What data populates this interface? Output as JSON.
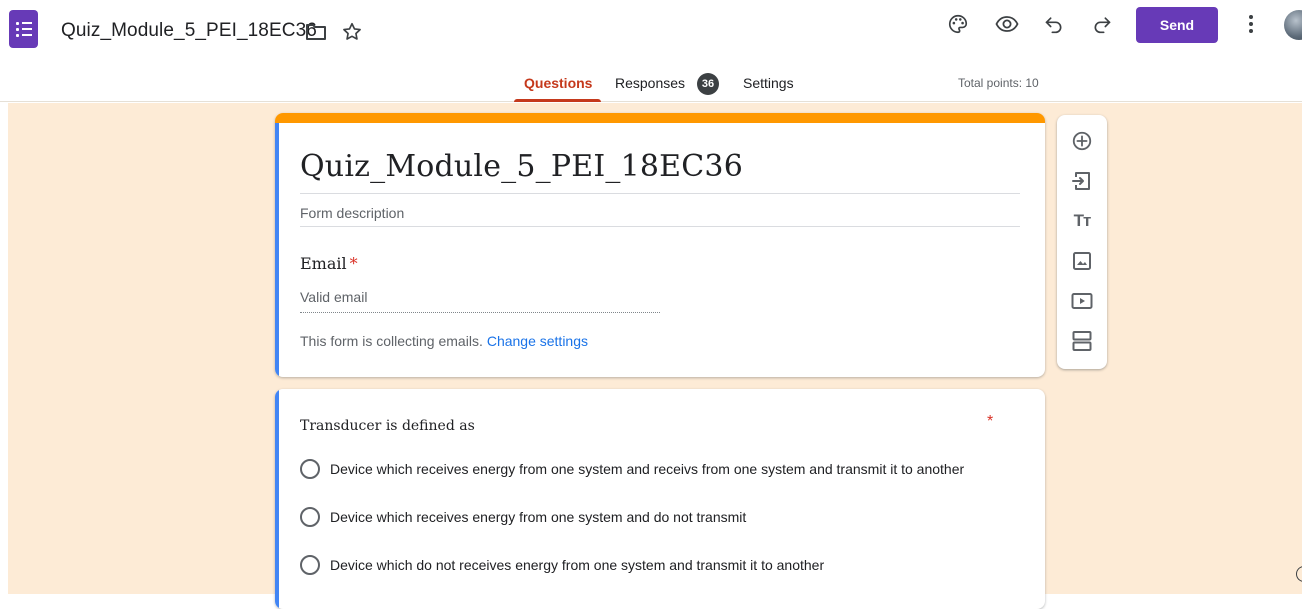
{
  "header": {
    "doc_title": "Quiz_Module_5_PEI_18EC36",
    "send_label": "Send",
    "icons": [
      "forms-logo-icon",
      "folder-icon",
      "star-icon",
      "palette-icon",
      "preview-eye-icon",
      "undo-icon",
      "redo-icon",
      "more-vert-icon",
      "avatar"
    ]
  },
  "tabs": {
    "questions": "Questions",
    "responses": "Responses",
    "responses_count": "36",
    "settings": "Settings",
    "total_points": "Total points: 10"
  },
  "form": {
    "title": "Quiz_Module_5_PEI_18EC36",
    "description_placeholder": "Form description",
    "email_label": "Email",
    "required_mark": "*",
    "email_placeholder": "Valid email",
    "collect_note": "This form is collecting emails.",
    "change_settings": "Change settings"
  },
  "question": {
    "title": "Transducer is defined as",
    "required_mark": "*",
    "options": [
      "Device which receives energy from one system and receivs from one system and transmit it to another",
      "Device which receives energy from one system and do not transmit",
      "Device which do not  receives energy from one system and transmit it to another"
    ]
  },
  "toolbar": {
    "items": [
      "add-question-icon",
      "import-questions-icon",
      "add-title-icon",
      "add-image-icon",
      "add-video-icon",
      "add-section-icon"
    ],
    "title_glyph": "Tт"
  },
  "colors": {
    "brand": "#673ab7",
    "header_stripe": "#ff9800",
    "canvas_bg": "#fdebd6",
    "active_tab": "#c5391c",
    "link": "#1a73e8",
    "focus_stripe": "#4285f4"
  }
}
